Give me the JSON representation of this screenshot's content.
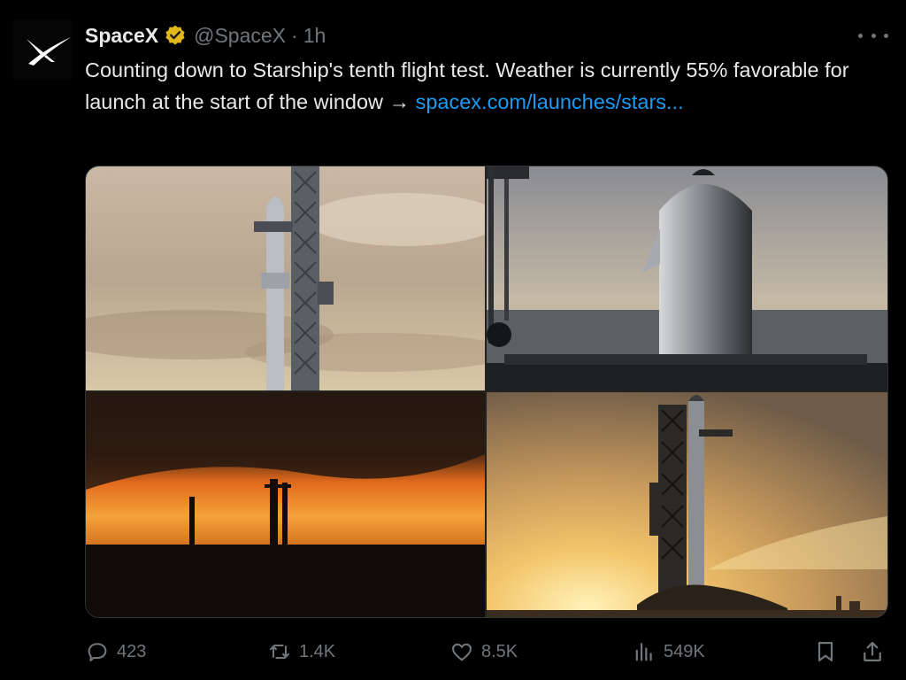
{
  "tweet": {
    "author_name": "SpaceX",
    "author_handle": "@SpaceX",
    "separator": "·",
    "time": "1h",
    "text": "Counting down to Starship's tenth flight test. Weather is currently 55% favorable for launch at the start of the window → ",
    "link_text": "spacex.com/launches/stars..."
  },
  "icons": {
    "avatar": "spacex-x-logo",
    "verified": "gold-verified-badge",
    "more": "more-dots-icon",
    "reply": "speech-bubble-icon",
    "retweet": "retweet-arrows-icon",
    "like": "heart-icon",
    "views": "bar-chart-icon",
    "bookmark": "bookmark-icon",
    "share": "upload-share-icon"
  },
  "metrics": {
    "replies": "423",
    "retweets": "1.4K",
    "likes": "8.5K",
    "views": "549K"
  },
  "colors": {
    "background": "#000000",
    "text": "#e7e9ea",
    "muted": "#71767b",
    "link": "#1d9bf0",
    "verified_gold": "#e2b719"
  }
}
